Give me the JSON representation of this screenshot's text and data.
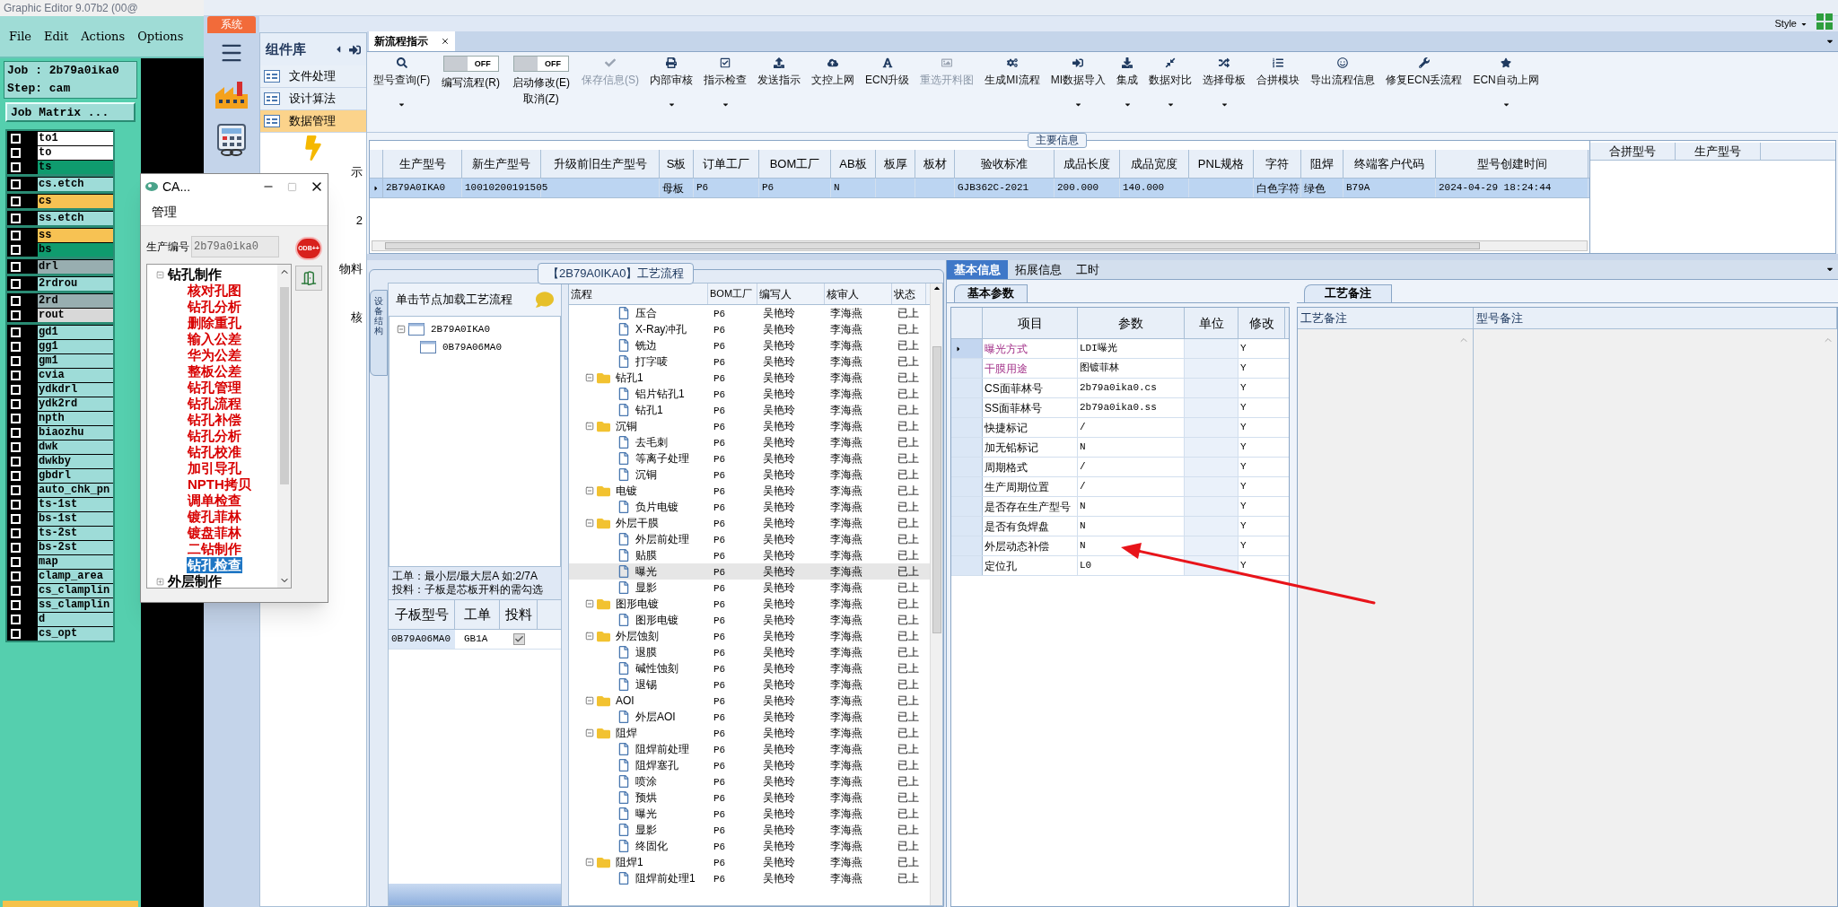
{
  "genesis": {
    "title": "Graphic Editor 9.07b2 (00@",
    "menu": [
      "File",
      "Edit",
      "Actions",
      "Options"
    ],
    "job": "Job : 2b79a0ika0",
    "step": "Step: cam",
    "job_matrix": "Job Matrix ...",
    "layer_groups": [
      {
        "layers": [
          {
            "name": "to1",
            "color": "#ffffff",
            "checked": false
          },
          {
            "name": "to",
            "color": "#ffffff",
            "checked": false
          },
          {
            "name": "ts",
            "color": "#0f9b6e",
            "checked": false
          }
        ]
      },
      {
        "layers": [
          {
            "name": "cs.etch",
            "color": "#9edcd8",
            "checked": false
          }
        ]
      },
      {
        "layers": [
          {
            "name": "cs",
            "color": "#f7c253",
            "checked": false
          }
        ]
      },
      {
        "layers": [
          {
            "name": "ss.etch",
            "color": "#9edcd8",
            "checked": false
          }
        ]
      },
      {
        "layers": [
          {
            "name": "ss",
            "color": "#f7c253",
            "checked": false
          },
          {
            "name": "bs",
            "color": "#0f9b6e",
            "checked": false
          }
        ]
      },
      {
        "layers": [
          {
            "name": "drl",
            "color": "#98aeb0",
            "checked": false
          }
        ]
      },
      {
        "layers": [
          {
            "name": "2rdrou",
            "color": "#9edcd8",
            "checked": false
          }
        ]
      },
      {
        "layers": [
          {
            "name": "2rd",
            "color": "#98aeb0",
            "checked": false
          },
          {
            "name": "rout",
            "color": "#d8d8d8",
            "checked": false
          }
        ]
      },
      {
        "layers": [
          {
            "name": "gd1",
            "color": "#9edcd8",
            "checked": false
          },
          {
            "name": "gg1",
            "color": "#9edcd8",
            "checked": false
          },
          {
            "name": "gm1",
            "color": "#9edcd8",
            "checked": false
          },
          {
            "name": "cvia",
            "color": "#9edcd8",
            "checked": false
          },
          {
            "name": "ydkdrl",
            "color": "#9edcd8",
            "checked": false
          },
          {
            "name": "ydk2rd",
            "color": "#9edcd8",
            "checked": false
          },
          {
            "name": "npth",
            "color": "#9edcd8",
            "checked": false
          },
          {
            "name": "biaozhu",
            "color": "#9edcd8",
            "checked": false
          },
          {
            "name": "dwk",
            "color": "#9edcd8",
            "checked": false
          },
          {
            "name": "dwkby",
            "color": "#9edcd8",
            "checked": false
          },
          {
            "name": "gbdrl",
            "color": "#9edcd8",
            "checked": false
          },
          {
            "name": "auto_chk_pn",
            "color": "#9edcd8",
            "checked": false
          },
          {
            "name": "ts-1st",
            "color": "#9edcd8",
            "checked": false
          },
          {
            "name": "bs-1st",
            "color": "#9edcd8",
            "checked": false
          },
          {
            "name": "ts-2st",
            "color": "#9edcd8",
            "checked": false
          },
          {
            "name": "bs-2st",
            "color": "#9edcd8",
            "checked": false
          },
          {
            "name": "map",
            "color": "#9edcd8",
            "checked": false
          },
          {
            "name": "clamp_area",
            "color": "#9edcd8",
            "checked": false
          },
          {
            "name": "cs_clamplin",
            "color": "#9edcd8",
            "checked": false
          },
          {
            "name": "ss_clamplin",
            "color": "#9edcd8",
            "checked": false
          },
          {
            "name": "d",
            "color": "#9edcd8",
            "checked": false
          },
          {
            "name": "cs_opt",
            "color": "#9edcd8",
            "checked": false
          }
        ]
      }
    ]
  },
  "system_tab": "系统",
  "component_panel": {
    "title": "组件库",
    "items": [
      {
        "label": "文件处理",
        "selected": false
      },
      {
        "label": "设计算法",
        "selected": false
      },
      {
        "label": "数据管理",
        "selected": true
      }
    ],
    "fragments": [
      "示",
      "2",
      "物料",
      "核"
    ]
  },
  "dialog": {
    "title": "CA...",
    "menu": [
      "管理"
    ],
    "field_label": "生产编号",
    "field_value": "2b79a0ika0",
    "odb_button": "ODB++",
    "tree": [
      {
        "label": "钻孔制作",
        "expanded": true,
        "children": [
          {
            "label": "核对孔图",
            "selected": false
          },
          {
            "label": "钻孔分析",
            "selected": false
          },
          {
            "label": "删除重孔",
            "selected": false
          },
          {
            "label": "输入公差",
            "selected": false
          },
          {
            "label": "华为公差",
            "selected": false
          },
          {
            "label": "整板公差",
            "selected": false
          },
          {
            "label": "钻孔管理",
            "selected": false
          },
          {
            "label": "钻孔流程",
            "selected": false
          },
          {
            "label": "钻孔补偿",
            "selected": false
          },
          {
            "label": "钻孔分析",
            "selected": false
          },
          {
            "label": "钻孔校准",
            "selected": false
          },
          {
            "label": "加引导孔",
            "selected": false
          },
          {
            "label": "NPTH拷贝",
            "selected": false
          },
          {
            "label": "调单检查",
            "selected": false
          },
          {
            "label": "镀孔菲林",
            "selected": false
          },
          {
            "label": "镀盘菲林",
            "selected": false
          },
          {
            "label": "二钻制作",
            "selected": false
          },
          {
            "label": "钻孔检查",
            "selected": true
          }
        ]
      },
      {
        "label": "外层制作",
        "expanded": false
      }
    ]
  },
  "style_menu": "Style",
  "doc_tabs": [
    {
      "label": "新流程指示",
      "selected": true
    }
  ],
  "toolbar": [
    {
      "kind": "button",
      "label": "型号查询(F)",
      "dropdown": true,
      "disabled": false
    },
    {
      "kind": "toggle",
      "switch_text": "OFF",
      "on": false,
      "label": "编写流程(R)"
    },
    {
      "kind": "toggle",
      "switch_text": "OFF",
      "on": false,
      "label": "启动修改(E)",
      "sublabel": "取消(Z)"
    },
    {
      "kind": "button",
      "label": "保存信息(S)",
      "dropdown": false,
      "disabled": true
    },
    {
      "kind": "button",
      "label": "内部审核",
      "dropdown": true,
      "disabled": false
    },
    {
      "kind": "button",
      "label": "指示检查",
      "dropdown": true,
      "disabled": false
    },
    {
      "kind": "button",
      "label": "发送指示",
      "dropdown": false,
      "disabled": false
    },
    {
      "kind": "button",
      "label": "文控上网",
      "dropdown": false,
      "disabled": false
    },
    {
      "kind": "button",
      "label": "ECN升级",
      "dropdown": false,
      "disabled": false
    },
    {
      "kind": "button",
      "label": "重选开料图",
      "dropdown": false,
      "disabled": true
    },
    {
      "kind": "button",
      "label": "生成MI流程",
      "dropdown": false,
      "disabled": false
    },
    {
      "kind": "button",
      "label": "MI数据导入",
      "dropdown": true,
      "disabled": false
    },
    {
      "kind": "button",
      "label": "集成",
      "dropdown": true,
      "disabled": false
    },
    {
      "kind": "button",
      "label": "数据对比",
      "dropdown": true,
      "disabled": false
    },
    {
      "kind": "button",
      "label": "选择母板",
      "dropdown": true,
      "disabled": false
    },
    {
      "kind": "button",
      "label": "合拼模块",
      "dropdown": false,
      "disabled": false
    },
    {
      "kind": "button",
      "label": "导出流程信息",
      "dropdown": false,
      "disabled": false
    },
    {
      "kind": "button",
      "label": "修复ECN丢流程",
      "dropdown": false,
      "disabled": false
    },
    {
      "kind": "button",
      "label": "ECN自动上网",
      "dropdown": true,
      "disabled": false
    }
  ],
  "main_info": {
    "title": "主要信息",
    "columns": [
      "生产型号",
      "新生产型号",
      "升级前旧生产型号",
      "S板",
      "订单工厂",
      "BOM工厂",
      "AB板",
      "板厚",
      "板材",
      "验收标准",
      "成品长度",
      "成品宽度",
      "PNL规格",
      "字符",
      "阻焊",
      "终端客户代码",
      "型号创建时间"
    ],
    "rows": [
      {
        "selected": true,
        "cells": [
          "2B79A0IKA0",
          "10010200191505",
          null,
          "母板",
          "P6",
          "P6",
          "N",
          null,
          null,
          "GJB362C-2021",
          "200.000",
          "140.000",
          null,
          "白色字符",
          "绿色",
          "B79A",
          "2024-04-29 18:24:44"
        ]
      }
    ],
    "side_columns": [
      "合拼型号",
      "生产型号"
    ]
  },
  "process_panel": {
    "title": "【2B79A0IKA0】工艺流程",
    "side_tab": "设备结构",
    "hint": "单击节点加载工艺流程",
    "tree": [
      {
        "label": "2B79A0IKA0",
        "expanded": true,
        "children": [
          {
            "label": "0B79A06MA0"
          }
        ]
      }
    ],
    "notes": [
      "工单：最小层/最大层A 如:2/7A",
      "投料：子板是芯板开料的需勾选"
    ],
    "sub_table": {
      "columns": [
        "子板型号",
        "工单",
        "投料"
      ],
      "rows": [
        {
          "model": "0B79A06MA0",
          "order": "GB1A",
          "checked": true
        }
      ]
    },
    "flow": {
      "columns": [
        "流程",
        "BOM工厂",
        "编写人",
        "核审人",
        "状态"
      ],
      "groups": [
        {
          "children": [
            {
              "label": "压合",
              "bom": "P6",
              "writer": "吴艳玲",
              "reviewer": "李海燕",
              "status": "已上",
              "selected": false
            },
            {
              "label": "X-Ray冲孔",
              "bom": "P6",
              "writer": "吴艳玲",
              "reviewer": "李海燕",
              "status": "已上",
              "selected": false
            },
            {
              "label": "铣边",
              "bom": "P6",
              "writer": "吴艳玲",
              "reviewer": "李海燕",
              "status": "已上",
              "selected": false
            },
            {
              "label": "打字唛",
              "bom": "P6",
              "writer": "吴艳玲",
              "reviewer": "李海燕",
              "status": "已上",
              "selected": false
            }
          ]
        },
        {
          "label": "钻孔1",
          "bom": "P6",
          "writer": "吴艳玲",
          "reviewer": "李海燕",
          "status": "已上",
          "selected": false,
          "expanded": true,
          "children": [
            {
              "label": "铝片钻孔1",
              "bom": "P6",
              "writer": "吴艳玲",
              "reviewer": "李海燕",
              "status": "已上",
              "selected": false
            },
            {
              "label": "钻孔1",
              "bom": "P6",
              "writer": "吴艳玲",
              "reviewer": "李海燕",
              "status": "已上",
              "selected": false
            }
          ]
        },
        {
          "label": "沉铜",
          "bom": "P6",
          "writer": "吴艳玲",
          "reviewer": "李海燕",
          "status": "已上",
          "selected": false,
          "expanded": true,
          "children": [
            {
              "label": "去毛刺",
              "bom": "P6",
              "writer": "吴艳玲",
              "reviewer": "李海燕",
              "status": "已上",
              "selected": false
            },
            {
              "label": "等离子处理",
              "bom": "P6",
              "writer": "吴艳玲",
              "reviewer": "李海燕",
              "status": "已上",
              "selected": false
            },
            {
              "label": "沉铜",
              "bom": "P6",
              "writer": "吴艳玲",
              "reviewer": "李海燕",
              "status": "已上",
              "selected": false
            }
          ]
        },
        {
          "label": "电镀",
          "bom": "P6",
          "writer": "吴艳玲",
          "reviewer": "李海燕",
          "status": "已上",
          "selected": false,
          "expanded": true,
          "children": [
            {
              "label": "负片电镀",
              "bom": "P6",
              "writer": "吴艳玲",
              "reviewer": "李海燕",
              "status": "已上",
              "selected": false
            }
          ]
        },
        {
          "label": "外层干膜",
          "bom": "P6",
          "writer": "吴艳玲",
          "reviewer": "李海燕",
          "status": "已上",
          "selected": false,
          "expanded": true,
          "children": [
            {
              "label": "外层前处理",
              "bom": "P6",
              "writer": "吴艳玲",
              "reviewer": "李海燕",
              "status": "已上",
              "selected": false
            },
            {
              "label": "贴膜",
              "bom": "P6",
              "writer": "吴艳玲",
              "reviewer": "李海燕",
              "status": "已上",
              "selected": false
            },
            {
              "label": "曝光",
              "bom": "P6",
              "writer": "吴艳玲",
              "reviewer": "李海燕",
              "status": "已上",
              "selected": true
            },
            {
              "label": "显影",
              "bom": "P6",
              "writer": "吴艳玲",
              "reviewer": "李海燕",
              "status": "已上",
              "selected": false
            }
          ]
        },
        {
          "label": "图形电镀",
          "bom": "P6",
          "writer": "吴艳玲",
          "reviewer": "李海燕",
          "status": "已上",
          "selected": false,
          "expanded": true,
          "children": [
            {
              "label": "图形电镀",
              "bom": "P6",
              "writer": "吴艳玲",
              "reviewer": "李海燕",
              "status": "已上",
              "selected": false
            }
          ]
        },
        {
          "label": "外层蚀刻",
          "bom": "P6",
          "writer": "吴艳玲",
          "reviewer": "李海燕",
          "status": "已上",
          "selected": false,
          "expanded": true,
          "children": [
            {
              "label": "退膜",
              "bom": "P6",
              "writer": "吴艳玲",
              "reviewer": "李海燕",
              "status": "已上",
              "selected": false
            },
            {
              "label": "碱性蚀刻",
              "bom": "P6",
              "writer": "吴艳玲",
              "reviewer": "李海燕",
              "status": "已上",
              "selected": false
            },
            {
              "label": "退锡",
              "bom": "P6",
              "writer": "吴艳玲",
              "reviewer": "李海燕",
              "status": "已上",
              "selected": false
            }
          ]
        },
        {
          "label": "AOI",
          "bom": "P6",
          "writer": "吴艳玲",
          "reviewer": "李海燕",
          "status": "已上",
          "selected": false,
          "expanded": true,
          "children": [
            {
              "label": "外层AOI",
              "bom": "P6",
              "writer": "吴艳玲",
              "reviewer": "李海燕",
              "status": "已上",
              "selected": false
            }
          ]
        },
        {
          "label": "阻焊",
          "bom": "P6",
          "writer": "吴艳玲",
          "reviewer": "李海燕",
          "status": "已上",
          "selected": false,
          "expanded": true,
          "children": [
            {
              "label": "阻焊前处理",
              "bom": "P6",
              "writer": "吴艳玲",
              "reviewer": "李海燕",
              "status": "已上",
              "selected": false
            },
            {
              "label": "阻焊塞孔",
              "bom": "P6",
              "writer": "吴艳玲",
              "reviewer": "李海燕",
              "status": "已上",
              "selected": false
            },
            {
              "label": "喷涂",
              "bom": "P6",
              "writer": "吴艳玲",
              "reviewer": "李海燕",
              "status": "已上",
              "selected": false
            },
            {
              "label": "预烘",
              "bom": "P6",
              "writer": "吴艳玲",
              "reviewer": "李海燕",
              "status": "已上",
              "selected": false
            },
            {
              "label": "曝光",
              "bom": "P6",
              "writer": "吴艳玲",
              "reviewer": "李海燕",
              "status": "已上",
              "selected": false
            },
            {
              "label": "显影",
              "bom": "P6",
              "writer": "吴艳玲",
              "reviewer": "李海燕",
              "status": "已上",
              "selected": false
            },
            {
              "label": "终固化",
              "bom": "P6",
              "writer": "吴艳玲",
              "reviewer": "李海燕",
              "status": "已上",
              "selected": false
            }
          ]
        },
        {
          "label": "阻焊1",
          "bom": "P6",
          "writer": "吴艳玲",
          "reviewer": "李海燕",
          "status": "已上",
          "selected": false,
          "expanded": true,
          "children": [
            {
              "label": "阻焊前处理1",
              "bom": "P6",
              "writer": "吴艳玲",
              "reviewer": "李海燕",
              "status": "已上",
              "selected": false
            }
          ]
        }
      ]
    }
  },
  "detail": {
    "tabs": [
      {
        "label": "基本信息",
        "selected": true
      },
      {
        "label": "拓展信息",
        "selected": false
      },
      {
        "label": "工时",
        "selected": false
      }
    ],
    "param_tab": "基本参数",
    "param_columns": [
      "项目",
      "参数",
      "单位",
      "修改"
    ],
    "params": [
      {
        "item": "曝光方式",
        "value": "LDI曝光",
        "modify": "Y",
        "highlighted": true,
        "selected": true
      },
      {
        "item": "干膜用途",
        "value": "图镀菲林",
        "modify": "Y",
        "highlighted": true,
        "selected": false
      },
      {
        "item": "CS面菲林号",
        "value": "2b79a0ika0.cs",
        "modify": "Y",
        "highlighted": false,
        "selected": false
      },
      {
        "item": "SS面菲林号",
        "value": "2b79a0ika0.ss",
        "modify": "Y",
        "highlighted": false,
        "selected": false
      },
      {
        "item": "快捷标记",
        "value": "/",
        "modify": "Y",
        "highlighted": false,
        "selected": false
      },
      {
        "item": "加无铅标记",
        "value": "N",
        "modify": "Y",
        "highlighted": false,
        "selected": false
      },
      {
        "item": "周期格式",
        "value": "/",
        "modify": "Y",
        "highlighted": false,
        "selected": false
      },
      {
        "item": "生产周期位置",
        "value": "/",
        "modify": "Y",
        "highlighted": false,
        "selected": false
      },
      {
        "item": "是否存在生产型号",
        "value": "N",
        "modify": "Y",
        "highlighted": false,
        "selected": false
      },
      {
        "item": "是否有负焊盘",
        "value": "N",
        "modify": "Y",
        "highlighted": false,
        "selected": false
      },
      {
        "item": "外层动态补偿",
        "value": "N",
        "modify": "Y",
        "highlighted": false,
        "selected": false
      },
      {
        "item": "定位孔",
        "value": "L0",
        "modify": "Y",
        "highlighted": false,
        "selected": false
      }
    ],
    "notes_tab": "工艺备注",
    "notes_columns": [
      "工艺备注",
      "型号备注"
    ]
  }
}
